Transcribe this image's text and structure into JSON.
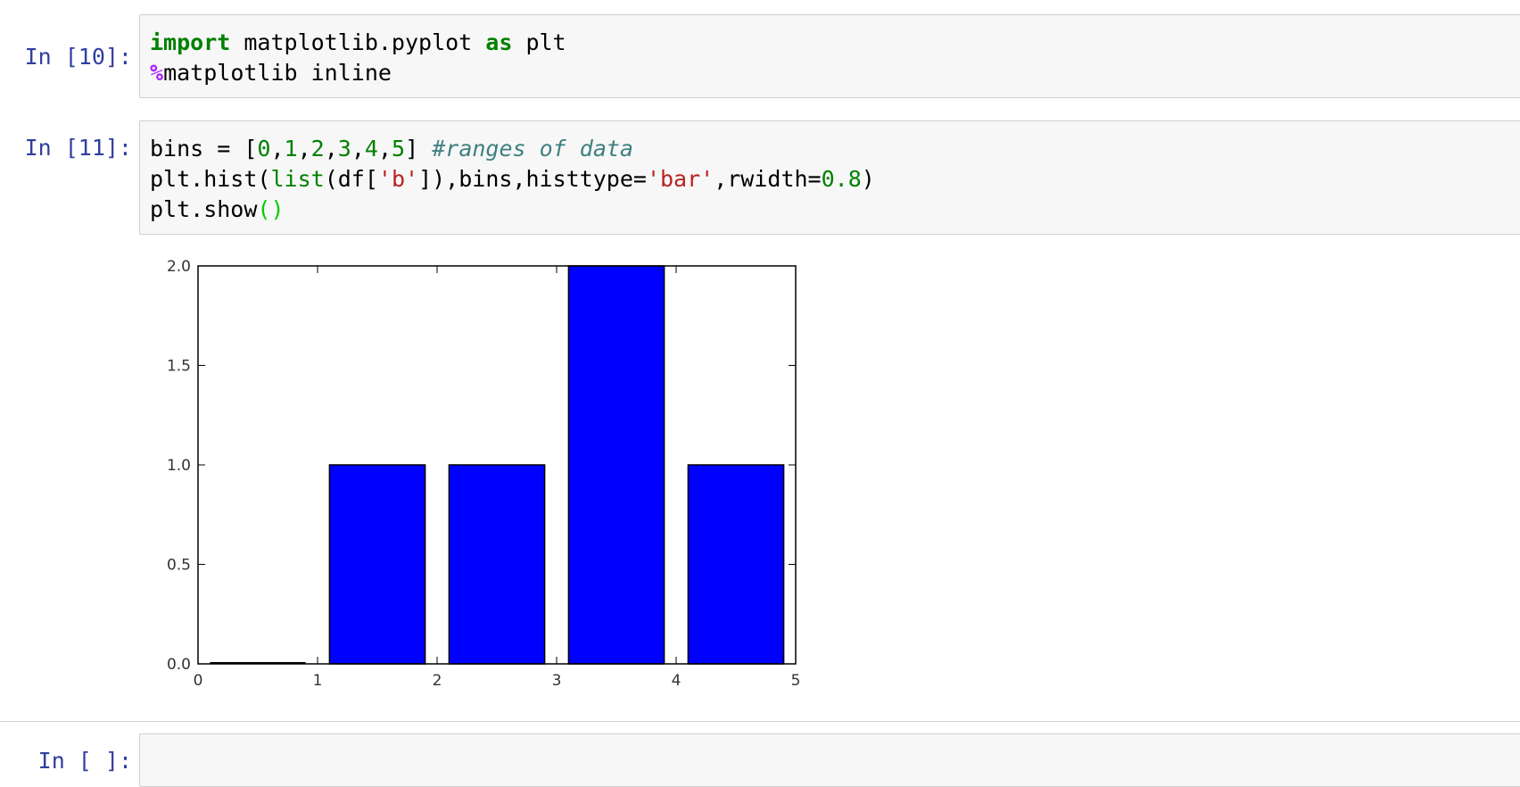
{
  "cells": [
    {
      "prompt": "In [10]:",
      "lines": [
        [
          {
            "cls": "kw",
            "text": "import"
          },
          {
            "cls": "",
            "text": " matplotlib.pyplot "
          },
          {
            "cls": "kw",
            "text": "as"
          },
          {
            "cls": "",
            "text": " plt"
          }
        ],
        [
          {
            "cls": "magic",
            "text": "%"
          },
          {
            "cls": "",
            "text": "matplotlib inline"
          }
        ]
      ]
    },
    {
      "prompt": "In [11]:",
      "lines": [
        [
          {
            "cls": "",
            "text": "bins = ["
          },
          {
            "cls": "num",
            "text": "0"
          },
          {
            "cls": "",
            "text": ","
          },
          {
            "cls": "num",
            "text": "1"
          },
          {
            "cls": "",
            "text": ","
          },
          {
            "cls": "num",
            "text": "2"
          },
          {
            "cls": "",
            "text": ","
          },
          {
            "cls": "num",
            "text": "3"
          },
          {
            "cls": "",
            "text": ","
          },
          {
            "cls": "num",
            "text": "4"
          },
          {
            "cls": "",
            "text": ","
          },
          {
            "cls": "num",
            "text": "5"
          },
          {
            "cls": "",
            "text": "] "
          },
          {
            "cls": "cmt",
            "text": "#ranges of data"
          }
        ],
        [
          {
            "cls": "",
            "text": "plt.hist("
          },
          {
            "cls": "bltn",
            "text": "list"
          },
          {
            "cls": "",
            "text": "(df["
          },
          {
            "cls": "str",
            "text": "'b'"
          },
          {
            "cls": "",
            "text": "]),bins,histtype="
          },
          {
            "cls": "str",
            "text": "'bar'"
          },
          {
            "cls": "",
            "text": ",rwidth="
          },
          {
            "cls": "num",
            "text": "0.8"
          },
          {
            "cls": "",
            "text": ")"
          }
        ],
        [
          {
            "cls": "",
            "text": "plt.show"
          },
          {
            "cls": "paren-green",
            "text": "()"
          }
        ]
      ]
    },
    {
      "prompt": "In [ ]:",
      "lines": []
    }
  ],
  "chart_data": {
    "type": "bar",
    "bins": [
      0,
      1,
      2,
      3,
      4,
      5
    ],
    "values": [
      0,
      1,
      1,
      2,
      1
    ],
    "rwidth": 0.8,
    "xlim": [
      0,
      5
    ],
    "ylim": [
      0,
      2
    ],
    "xticks": [
      "0",
      "1",
      "2",
      "3",
      "4",
      "5"
    ],
    "yticks": [
      "0.0",
      "0.5",
      "1.0",
      "1.5",
      "2.0"
    ],
    "bar_color": "#0000ff",
    "title": "",
    "xlabel": "",
    "ylabel": ""
  }
}
